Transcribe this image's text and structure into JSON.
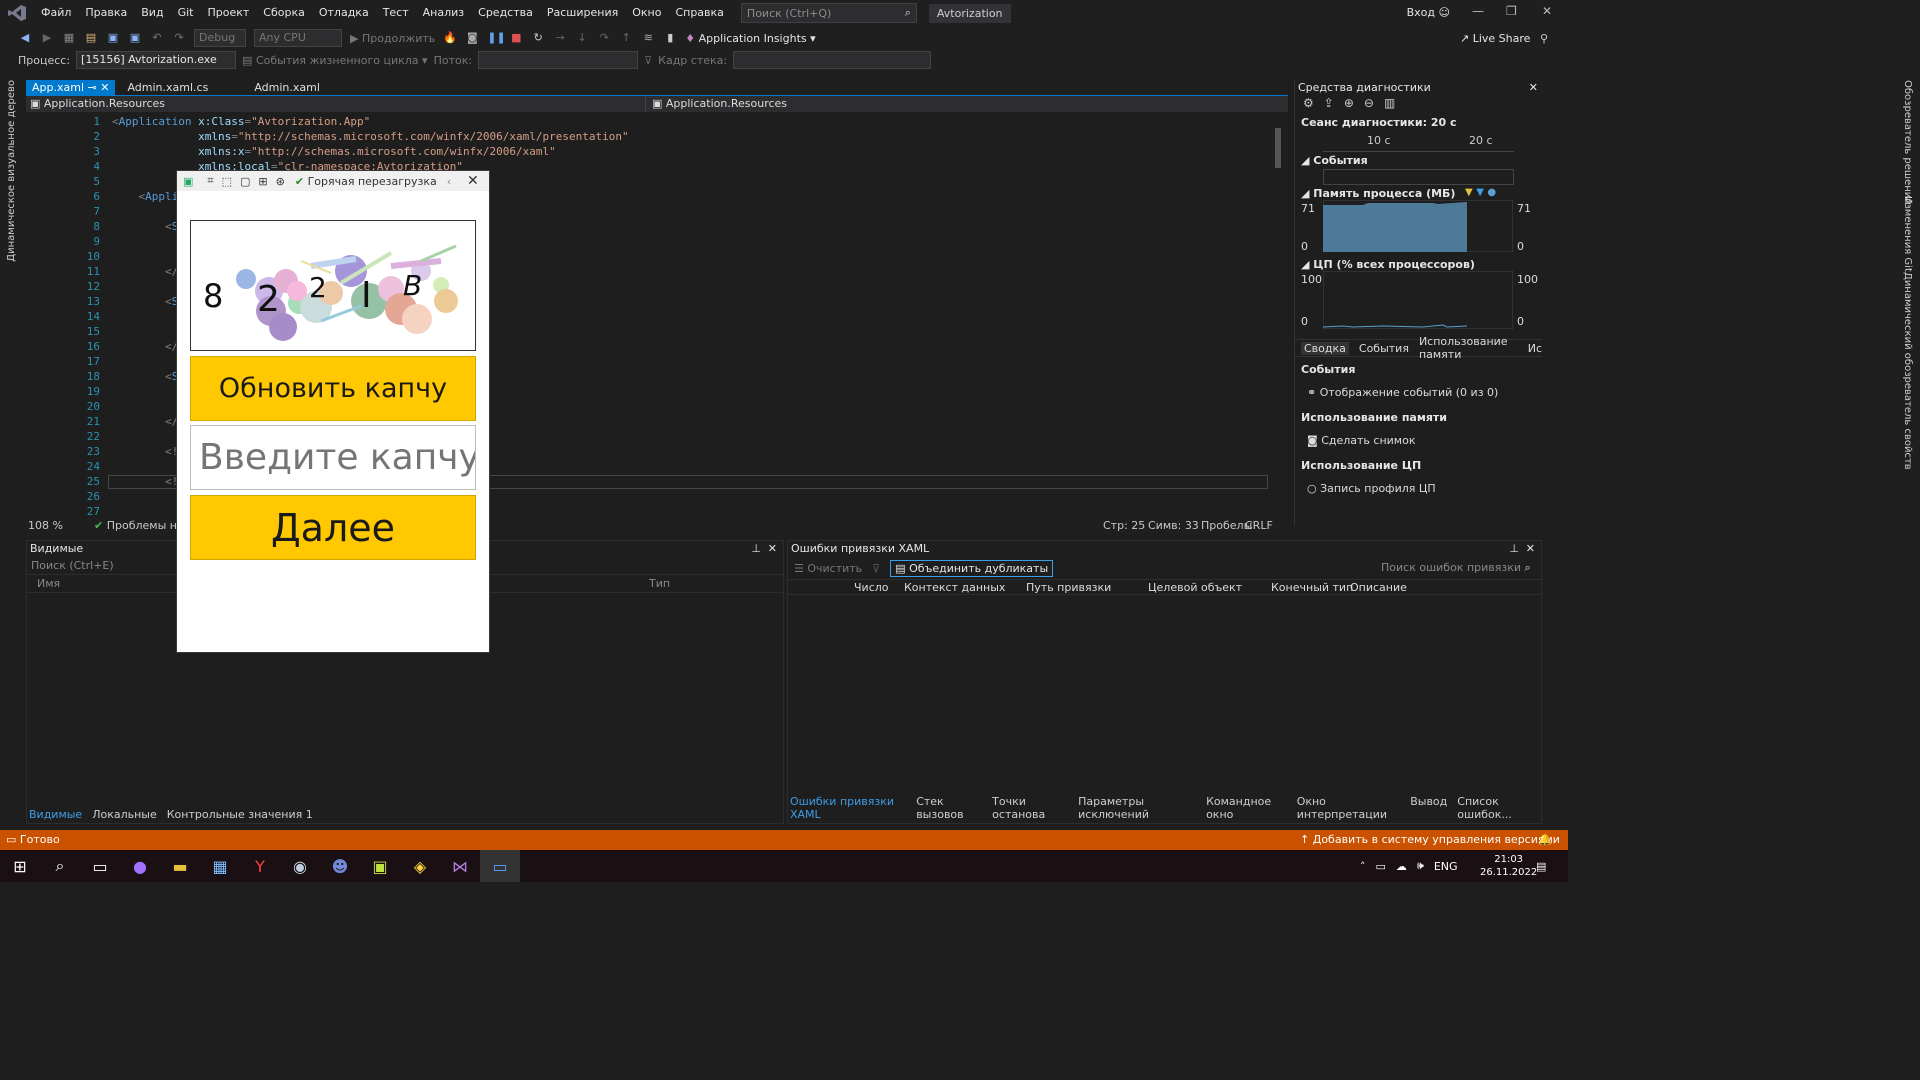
{
  "menubar": {
    "items": [
      "Файл",
      "Правка",
      "Вид",
      "Git",
      "Проект",
      "Сборка",
      "Отладка",
      "Тест",
      "Анализ",
      "Средства",
      "Расширения",
      "Окно",
      "Справка"
    ],
    "search_placeholder": "Поиск (Ctrl+Q)",
    "solution_name": "Avtorization",
    "login": "Вход"
  },
  "toolbar": {
    "config": "Debug",
    "platform": "Any CPU",
    "continue_label": "Продолжить",
    "app_insights": "Application Insights",
    "live_share": "Live Share"
  },
  "toolbar2": {
    "process_label": "Процесс:",
    "process_value": "[15156] Avtorization.exe",
    "lifecycle_events": "События жизненного цикла",
    "thread_label": "Поток:",
    "stack_frame_label": "Кадр стека:"
  },
  "left_strip_label": "Динамическое визуальное дерево",
  "right_strip_labels": [
    "Обозреватель решений",
    "Изменения Git",
    "Динамический обозреватель свойств"
  ],
  "doc_tabs": [
    {
      "label": "App.xaml",
      "active": true
    },
    {
      "label": "Admin.xaml.cs",
      "active": false
    },
    {
      "label": "Admin.xaml",
      "active": false
    }
  ],
  "navbar": {
    "left": "Application.Resources",
    "right": "Application.Resources"
  },
  "editor": {
    "lines": [
      {
        "n": "1",
        "segments": [
          [
            "t-pun",
            "<"
          ],
          [
            "t-tag",
            "Application "
          ],
          [
            "t-attr",
            "x:Class"
          ],
          [
            "t-pun",
            "="
          ],
          [
            "t-str",
            "\"Avtorization.App\""
          ]
        ]
      },
      {
        "n": "2",
        "segments": [
          [
            "t-el",
            "             "
          ],
          [
            "t-attr",
            "xmlns"
          ],
          [
            "t-pun",
            "="
          ],
          [
            "t-str",
            "\"http://schemas.microsoft.com/winfx/2006/xaml/presentation\""
          ]
        ]
      },
      {
        "n": "3",
        "segments": [
          [
            "t-el",
            "             "
          ],
          [
            "t-attr",
            "xmlns:x"
          ],
          [
            "t-pun",
            "="
          ],
          [
            "t-str",
            "\"http://schemas.microsoft.com/winfx/2006/xaml\""
          ]
        ]
      },
      {
        "n": "4",
        "segments": [
          [
            "t-el",
            "             "
          ],
          [
            "t-attr",
            "xmlns:local"
          ],
          [
            "t-pun",
            "="
          ],
          [
            "t-str",
            "\"clr-namespace:Avtorization\""
          ]
        ]
      },
      {
        "n": "5",
        "segments": []
      },
      {
        "n": "6",
        "segments": [
          [
            "t-el",
            "    "
          ],
          [
            "t-pun",
            "<"
          ],
          [
            "t-tag",
            "Applic"
          ]
        ]
      },
      {
        "n": "7",
        "segments": []
      },
      {
        "n": "8",
        "segments": [
          [
            "t-el",
            "        "
          ],
          [
            "t-pun",
            "<"
          ],
          [
            "t-tag",
            "So"
          ]
        ]
      },
      {
        "n": "9",
        "segments": []
      },
      {
        "n": "10",
        "segments": []
      },
      {
        "n": "11",
        "segments": [
          [
            "t-el",
            "        "
          ],
          [
            "t-pun",
            "</"
          ],
          [
            "t-tag",
            "S"
          ]
        ]
      },
      {
        "n": "12",
        "segments": []
      },
      {
        "n": "13",
        "segments": [
          [
            "t-el",
            "        "
          ],
          [
            "t-pun",
            "<"
          ],
          [
            "t-tag",
            "So"
          ]
        ]
      },
      {
        "n": "14",
        "segments": []
      },
      {
        "n": "15",
        "segments": []
      },
      {
        "n": "16",
        "segments": [
          [
            "t-el",
            "        "
          ],
          [
            "t-pun",
            "</"
          ],
          [
            "t-tag",
            "S"
          ]
        ]
      },
      {
        "n": "17",
        "segments": []
      },
      {
        "n": "18",
        "segments": [
          [
            "t-el",
            "        "
          ],
          [
            "t-pun",
            "<"
          ],
          [
            "t-tag",
            "So"
          ]
        ]
      },
      {
        "n": "19",
        "segments": []
      },
      {
        "n": "20",
        "segments": []
      },
      {
        "n": "21",
        "segments": [
          [
            "t-el",
            "        "
          ],
          [
            "t-pun",
            "</"
          ],
          [
            "t-tag",
            "S"
          ]
        ]
      },
      {
        "n": "22",
        "segments": []
      },
      {
        "n": "23",
        "segments": [
          [
            "t-el",
            "        "
          ],
          [
            "t-pun",
            "<!-"
          ]
        ]
      },
      {
        "n": "24",
        "segments": []
      },
      {
        "n": "25",
        "segments": [
          [
            "t-el",
            "        "
          ],
          [
            "t-pun",
            "<!-"
          ]
        ]
      },
      {
        "n": "26",
        "segments": []
      },
      {
        "n": "27",
        "segments": []
      }
    ]
  },
  "status_line": {
    "zoom": "108 %",
    "problems": "Проблемы не н",
    "line": "Стр: 25",
    "char": "Симв: 33",
    "spaces": "Пробелы",
    "eol": "CRLF"
  },
  "locals_panel": {
    "title": "Видимые",
    "search_placeholder": "Поиск (Ctrl+E)",
    "col_name": "Имя",
    "col_type": "Тип",
    "tabs": [
      "Видимые",
      "Локальные",
      "Контрольные значения 1"
    ]
  },
  "binding_panel": {
    "title": "Ошибки привязки XAML",
    "clear": "Очистить",
    "merge": "Объединить дубликаты",
    "search_placeholder": "Поиск ошибок привязки",
    "columns": [
      "Число",
      "Контекст данных",
      "Путь привязки",
      "Целевой объект",
      "Конечный тип",
      "Описание"
    ],
    "tabs": [
      "Ошибки привязки XAML",
      "Стек вызовов",
      "Точки останова",
      "Параметры исключений",
      "Командное окно",
      "Окно интерпретации",
      "Вывод",
      "Список ошибок..."
    ]
  },
  "diagnostics": {
    "title": "Средства диагностики",
    "session": "Сеанс диагностики: 20 с",
    "tick_10": "10 с",
    "tick_20": "20 с",
    "events_header": "События",
    "memory_header": "Память процесса (МБ)",
    "mem_max": "71",
    "mem_min": "0",
    "cpu_header": "ЦП (% всех процессоров)",
    "cpu_max": "100",
    "cpu_min": "0",
    "tabs": [
      "Сводка",
      "События",
      "Использование памяти",
      "Ис"
    ],
    "s_events": "События",
    "show_events": "Отображение событий (0 из 0)",
    "s_memory": "Использование памяти",
    "snapshot": "Сделать снимок",
    "s_cpu": "Использование ЦП",
    "cpu_profile": "Запись профиля ЦП"
  },
  "statusbar": {
    "ready": "Готово",
    "add_vcs": "Добавить в систему управления версиями"
  },
  "taskbar": {
    "lang": "ENG",
    "time": "21:03",
    "date": "26.11.2022"
  },
  "app_window": {
    "hot_reload": "Горячая перезагрузка",
    "captcha_chars": [
      "8",
      "2",
      "2",
      "I",
      "B"
    ],
    "refresh_button": "Обновить капчу",
    "input_placeholder": "Введите капчу",
    "next_button": "Далее"
  },
  "colors": {
    "accent": "#007acc",
    "statusbar": "#ca5100",
    "app_button": "#ffc800"
  }
}
